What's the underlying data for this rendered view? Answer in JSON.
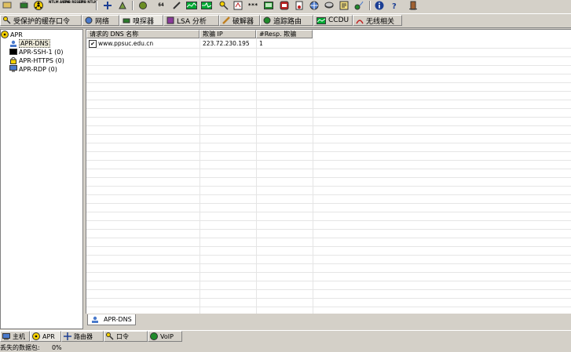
{
  "toolbar": {
    "btn_ntlm_auth": "NTLM AUTH",
    "btn_smb_reset": "SMB RESET",
    "btn_smb_ntlm": "SMB NTLM",
    "btn_num64": "64",
    "btn_stars": "***"
  },
  "tabs": [
    {
      "label": "受保护的缓存口令"
    },
    {
      "label": "网络"
    },
    {
      "label": "嗅探器"
    },
    {
      "label": "LSA 分析"
    },
    {
      "label": "破解器"
    },
    {
      "label": "追踪路由"
    },
    {
      "label": "CCDU"
    },
    {
      "label": "无线相关"
    }
  ],
  "tree": {
    "root": "APR",
    "items": [
      {
        "label": "APR-DNS"
      },
      {
        "label": "APR-SSH-1  (0)"
      },
      {
        "label": "APR-HTTPS  (0)"
      },
      {
        "label": "APR-RDP  (0)"
      }
    ]
  },
  "table": {
    "columns": [
      "请求的 DNS 名称",
      "欺骗 IP",
      "#Resp. 欺骗"
    ],
    "rows": [
      {
        "checked": true,
        "check_mark": "✔",
        "name": "www.ppsuc.edu.cn",
        "ip": "223.72.230.195",
        "resp": "1"
      }
    ]
  },
  "subtab": {
    "label": "APR-DNS"
  },
  "bottom_tabs": [
    {
      "label": "主机"
    },
    {
      "label": "APR"
    },
    {
      "label": "路由器"
    },
    {
      "label": "口令"
    },
    {
      "label": "VoIP"
    }
  ],
  "status": {
    "text": "丢失的数据包:      0%"
  },
  "colors": {
    "accent_blue": "#1c3f94",
    "yellow": "#f5d000",
    "green": "#1f8a2a",
    "red": "#c02020"
  }
}
